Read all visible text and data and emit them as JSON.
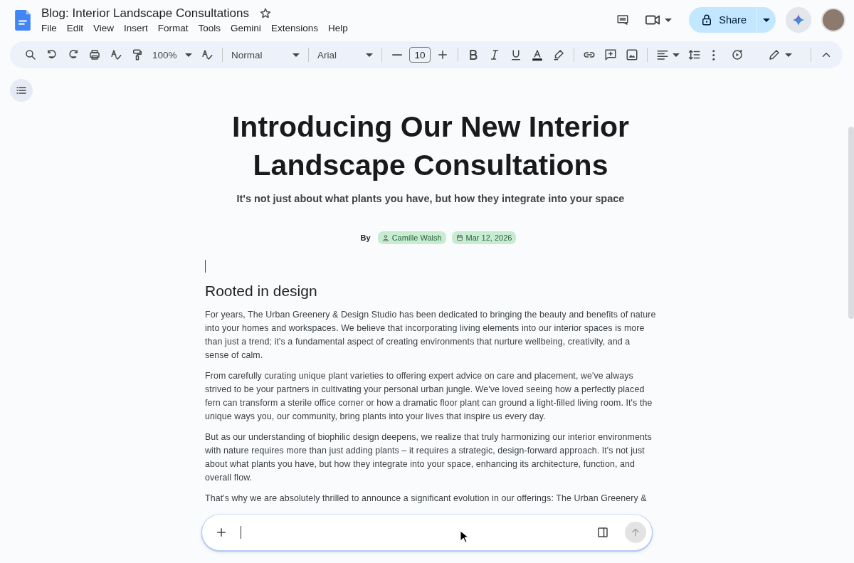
{
  "window": {
    "title": "Blog: Interior Landscape Consultations",
    "starred": false
  },
  "menu": [
    "File",
    "Edit",
    "View",
    "Insert",
    "Format",
    "Tools",
    "Gemini",
    "Extensions",
    "Help"
  ],
  "share_button": {
    "label": "Share"
  },
  "toolbar": {
    "zoom": "100%",
    "style": "Normal",
    "font": "Arial",
    "font_size": "10"
  },
  "document": {
    "title": "Introducing Our New Interior Landscape Consultations",
    "subtitle": "It's not just about what plants you have, but how they integrate into your space",
    "byline": {
      "label": "By",
      "chips": [
        {
          "kind": "person",
          "text": "Camille Walsh"
        },
        {
          "kind": "date",
          "text": "Mar 12, 2026"
        }
      ]
    },
    "heading": "Rooted in design",
    "paragraphs": [
      "For years, The Urban Greenery & Design Studio has been dedicated to bringing the beauty and benefits of nature into your homes and workspaces. We believe that incorporating living elements into our interior spaces is more than just a trend; it's a fundamental aspect of creating environments that nurture wellbeing, creativity, and a sense of calm.",
      "From carefully curating unique plant varieties to offering expert advice on care and placement, we've always strived to be your partners in cultivating your personal urban jungle. We've loved seeing how a perfectly placed fern can transform a sterile office corner or how a dramatic floor plant can ground a light-filled living room. It's the unique ways you, our community, bring plants into your lives that inspire us every day.",
      "But as our understanding of biophilic design deepens, we realize that truly harmonizing our interior environments with nature requires more than just adding plants – it requires a strategic, design-forward approach. It's not just about what plants you have, but how they integrate into your space, enhancing its architecture, function, and overall flow.",
      "That's why we are absolutely thrilled to announce a significant evolution in our offerings: The Urban Greenery &"
    ]
  }
}
